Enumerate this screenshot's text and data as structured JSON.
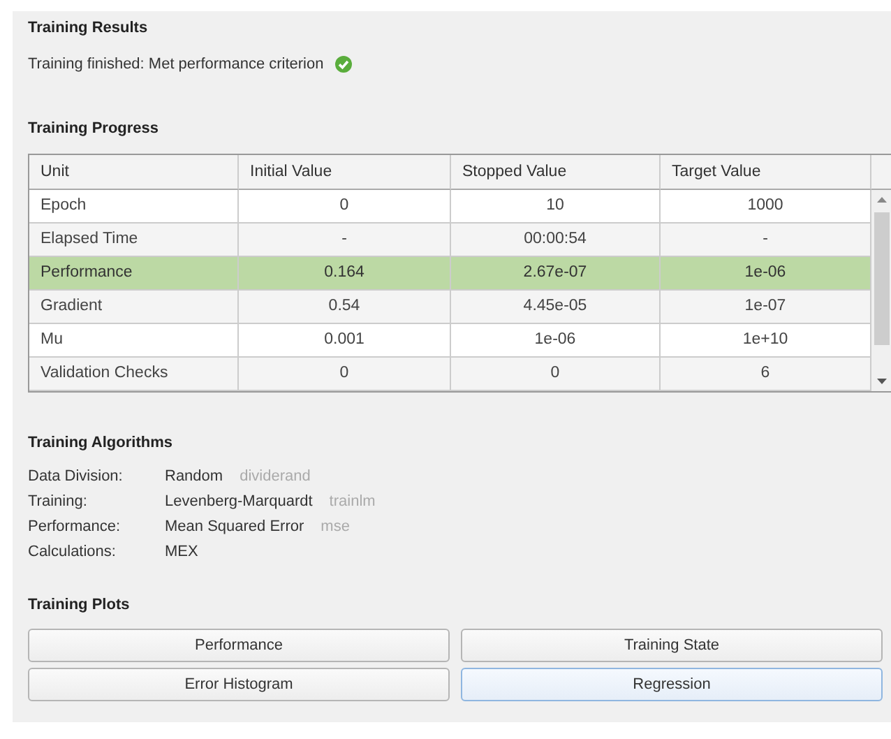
{
  "results": {
    "title": "Training Results",
    "message": "Training finished: Met performance criterion",
    "success": true
  },
  "progress": {
    "title": "Training Progress",
    "columns": [
      "Unit",
      "Initial Value",
      "Stopped Value",
      "Target Value"
    ],
    "rows": [
      {
        "cells": [
          "Epoch",
          "0",
          "10",
          "1000"
        ],
        "selected": false
      },
      {
        "cells": [
          "Elapsed Time",
          "-",
          "00:00:54",
          "-"
        ],
        "selected": false
      },
      {
        "cells": [
          "Performance",
          "0.164",
          "2.67e-07",
          "1e-06"
        ],
        "selected": true
      },
      {
        "cells": [
          "Gradient",
          "0.54",
          "4.45e-05",
          "1e-07"
        ],
        "selected": false
      },
      {
        "cells": [
          "Mu",
          "0.001",
          "1e-06",
          "1e+10"
        ],
        "selected": false
      },
      {
        "cells": [
          "Validation Checks",
          "0",
          "0",
          "6"
        ],
        "selected": false
      }
    ]
  },
  "algorithms": {
    "title": "Training Algorithms",
    "items": [
      {
        "label": "Data Division:",
        "value": "Random",
        "function": "dividerand"
      },
      {
        "label": "Training:",
        "value": "Levenberg-Marquardt",
        "function": "trainlm"
      },
      {
        "label": "Performance:",
        "value": "Mean Squared Error",
        "function": "mse"
      },
      {
        "label": "Calculations:",
        "value": "MEX"
      }
    ]
  },
  "plots": {
    "title": "Training Plots",
    "buttons": [
      {
        "label": "Performance",
        "focused": false
      },
      {
        "label": "Training State",
        "focused": false
      },
      {
        "label": "Error Histogram",
        "focused": false
      },
      {
        "label": "Regression",
        "focused": true
      }
    ]
  }
}
